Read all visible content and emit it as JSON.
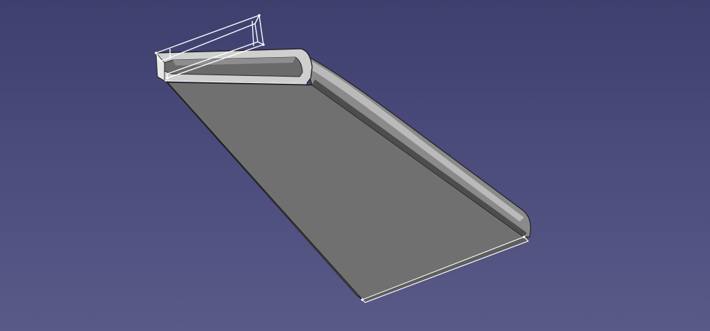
{
  "viewport": {
    "background_top": "#3f3f6e",
    "background_bottom": "#5a5a88"
  },
  "model": {
    "face_color": "#717171",
    "rail_color": "#8a8a8a",
    "highlight_color": "#d6d6d6",
    "edge_color": "#ffffff",
    "outline_color": "#1f1f1f"
  }
}
